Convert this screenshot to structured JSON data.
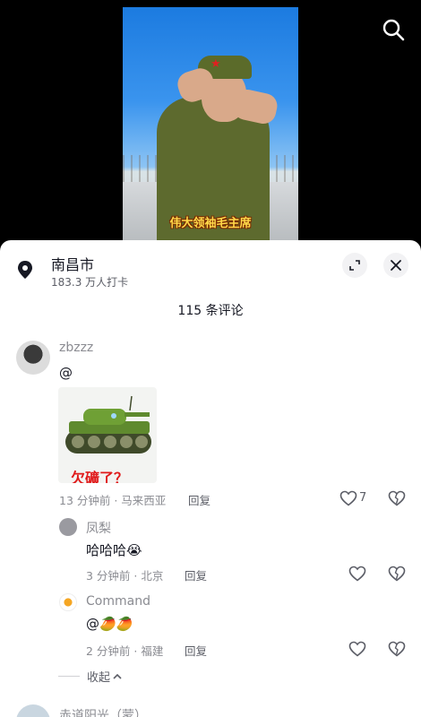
{
  "video": {
    "subtitle": "伟大领袖毛主席"
  },
  "location": {
    "name": "南昌市",
    "checkins": "183.3 万人打卡"
  },
  "comments_header": {
    "count_label": "115 条评论"
  },
  "comments": [
    {
      "user": "zbzzz",
      "text": "@",
      "sticker_text": "欠礦了？",
      "time_place": "13 分钟前 · 马来西亚",
      "reply_label": "回复",
      "likes": "7"
    }
  ],
  "replies": [
    {
      "user": "凤梨",
      "text": "哈哈哈😭",
      "time_place": "3 分钟前 · 北京",
      "reply_label": "回复"
    },
    {
      "user": "Command",
      "text": "@🥭🥭",
      "time_place": "2 分钟前 · 福建",
      "reply_label": "回复"
    }
  ],
  "collapse_label": "收起",
  "next_comment": {
    "user": "赤道阳光（蒙）"
  },
  "colors": {
    "accent": "#161823",
    "muted": "#8a8b91",
    "sheet": "#ffffff"
  }
}
